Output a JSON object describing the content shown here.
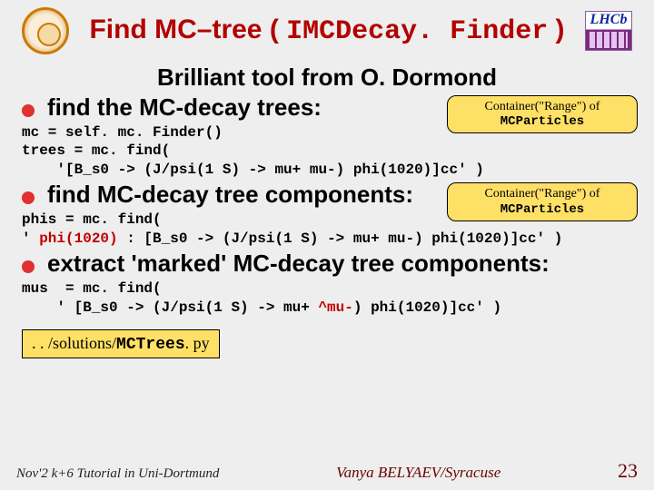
{
  "title": {
    "prefix": "Find MC–tree ( ",
    "mono": "IMCDecay. Finder",
    "suffix": " )"
  },
  "lhcb_label": "LHCb",
  "subtitle": "Brilliant tool from O. Dormond",
  "bullets": {
    "b1": "find the MC-decay trees:",
    "b2": "find MC-decay tree components:",
    "b3": "extract 'marked' MC-decay tree components:"
  },
  "callout": {
    "line1": "Container(\"Range\") of",
    "line2": "MCParticles"
  },
  "code": {
    "block1_l1": "mc = self. mc. Finder()",
    "block1_l2": "trees = mc. find(",
    "block1_l3": "    '[B_s0 -> (J/psi(1 S) -> mu+ mu-) phi(1020)]cc' )",
    "block2_l1": "phis = mc. find(",
    "block2_l2_a": "' ",
    "block2_l2_hl": "phi(1020)",
    "block2_l2_b": " : [B_s0 -> (J/psi(1 S) -> mu+ mu-) phi(1020)]cc' )",
    "block3_l1": "mus  = mc. find(",
    "block3_l2_a": "    ' [B_s0 -> (J/psi(1 S) -> mu+ ",
    "block3_l2_hl": "^mu-",
    "block3_l2_b": ") phi(1020)]cc' )"
  },
  "filebox": {
    "prefix": ". . /solutions/",
    "mono": "MCTrees",
    "suffix": ". py"
  },
  "footer": {
    "left": "Nov'2 k+6  Tutorial in Uni-Dortmund",
    "center": "Vanya  BELYAEV/Syracuse",
    "right": "23"
  }
}
